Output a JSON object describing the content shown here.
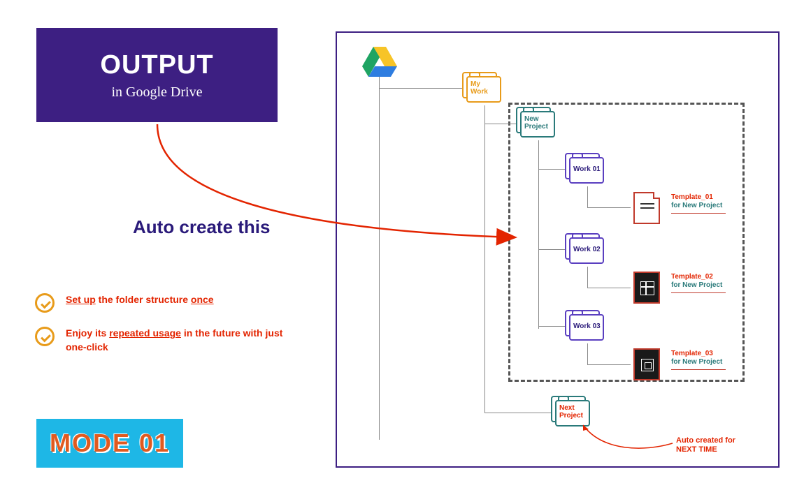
{
  "output": {
    "title": "OUTPUT",
    "subtitle": "in Google Drive"
  },
  "auto_create": "Auto create this",
  "bullets": {
    "b1_pre": "Set up",
    "b1_mid": " the folder structure ",
    "b1_post": "once",
    "b2_pre": "Enjoy its ",
    "b2_mid": "repeated usage",
    "b2_post": " in the future with just one-click"
  },
  "mode": "MODE 01",
  "folders": {
    "my_work": "My\nWork",
    "new_project": "New\nProject",
    "work01": "Work 01",
    "work02": "Work 02",
    "work03": "Work 03",
    "next_project": "Next\nProject"
  },
  "files": {
    "t1_name": "Template_01",
    "t1_sub": "for New Project",
    "t2_name": "Template_02",
    "t2_sub": "for New Project",
    "t3_name": "Template_03",
    "t3_sub": "for New Project"
  },
  "next_note_l1": "Auto created for",
  "next_note_l2": "NEXT TIME"
}
